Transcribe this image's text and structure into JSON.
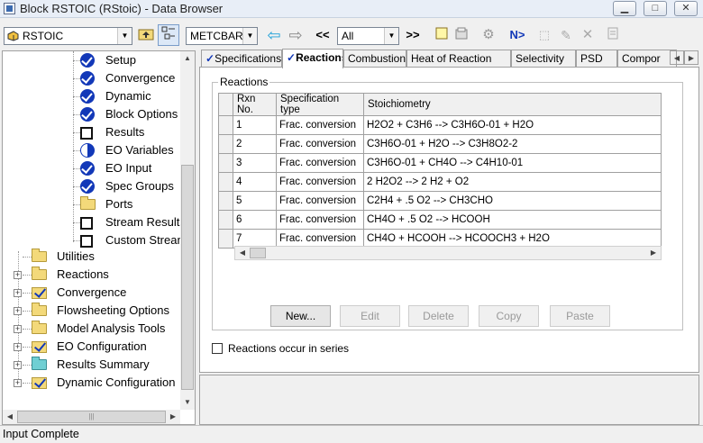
{
  "window": {
    "title": "Block RSTOIC (RStoic) - Data Browser",
    "buttons": [
      "minimize",
      "restore",
      "close"
    ]
  },
  "toolbar": {
    "block_combo": "RSTOIC",
    "units_combo": "METCBAR",
    "filter_combo": "All",
    "prev_label": "<<",
    "next_label": ">>",
    "next_step_label": "N>"
  },
  "tree": {
    "items": [
      {
        "label": "Setup",
        "icon": "blue-check-icon"
      },
      {
        "label": "Convergence",
        "icon": "blue-check-icon"
      },
      {
        "label": "Dynamic",
        "icon": "blue-check-icon"
      },
      {
        "label": "Block Options",
        "icon": "blue-check-icon"
      },
      {
        "label": "Results",
        "icon": "empty-box-icon"
      },
      {
        "label": "EO Variables",
        "icon": "half-circle-icon"
      },
      {
        "label": "EO Input",
        "icon": "blue-check-icon"
      },
      {
        "label": "Spec Groups",
        "icon": "blue-check-icon"
      },
      {
        "label": "Ports",
        "icon": "folder-icon"
      },
      {
        "label": "Stream Results",
        "icon": "empty-box-icon"
      },
      {
        "label": "Custom Stream",
        "icon": "empty-box-icon"
      }
    ],
    "roots": [
      {
        "label": "Utilities",
        "icon": "folder-icon"
      },
      {
        "label": "Reactions",
        "icon": "folder-icon"
      },
      {
        "label": "Convergence",
        "icon": "folder-check-icon"
      },
      {
        "label": "Flowsheeting Options",
        "icon": "folder-icon"
      },
      {
        "label": "Model Analysis Tools",
        "icon": "folder-icon"
      },
      {
        "label": "EO Configuration",
        "icon": "folder-check-icon"
      },
      {
        "label": "Results Summary",
        "icon": "teal-folder-icon"
      },
      {
        "label": "Dynamic Configuration",
        "icon": "folder-check-icon"
      }
    ]
  },
  "tabs": [
    {
      "label": "Specifications",
      "checked": true
    },
    {
      "label": "Reactions",
      "checked": true,
      "active": true
    },
    {
      "label": "Combustion"
    },
    {
      "label": "Heat of Reaction"
    },
    {
      "label": "Selectivity"
    },
    {
      "label": "PSD"
    },
    {
      "label": "Compor"
    }
  ],
  "reactions": {
    "group_label": "Reactions",
    "columns": [
      "Rxn No.",
      "Specification type",
      "Stoichiometry"
    ],
    "rows": [
      {
        "no": "1",
        "spec": "Frac. conversion",
        "stoich": "H2O2 + C3H6 --> C3H6O-01 + H2O"
      },
      {
        "no": "2",
        "spec": "Frac. conversion",
        "stoich": "C3H6O-01 + H2O --> C3H8O2-2"
      },
      {
        "no": "3",
        "spec": "Frac. conversion",
        "stoich": "C3H6O-01 + CH4O --> C4H10-01"
      },
      {
        "no": "4",
        "spec": "Frac. conversion",
        "stoich": "2 H2O2 --> 2 H2 + O2"
      },
      {
        "no": "5",
        "spec": "Frac. conversion",
        "stoich": "C2H4 + .5 O2 --> CH3CHO"
      },
      {
        "no": "6",
        "spec": "Frac. conversion",
        "stoich": "CH4O + .5 O2 --> HCOOH"
      },
      {
        "no": "7",
        "spec": "Frac. conversion",
        "stoich": "CH4O + HCOOH --> HCOOCH3 + H2O"
      }
    ],
    "buttons": {
      "new": "New...",
      "edit": "Edit",
      "delete": "Delete",
      "copy": "Copy",
      "paste": "Paste"
    },
    "series_label": "Reactions occur in series",
    "series_checked": false
  },
  "status": {
    "text": "Input Complete"
  }
}
